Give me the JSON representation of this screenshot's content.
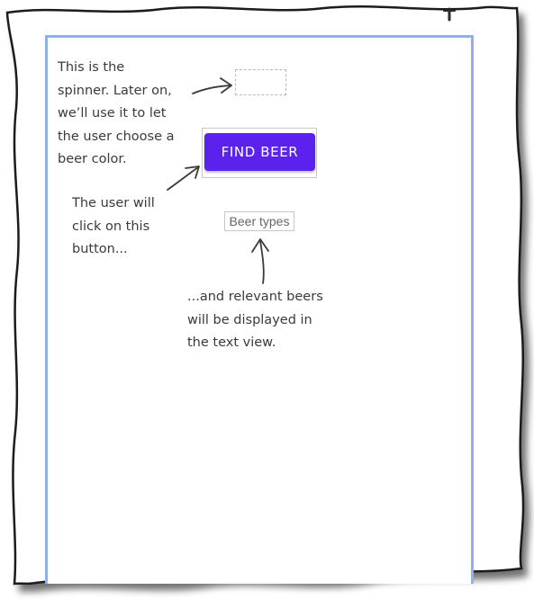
{
  "spinner": {
    "value": ""
  },
  "find_button": {
    "label": "FIND BEER"
  },
  "text_view": {
    "text": "Beer types"
  },
  "annotations": {
    "spinner_note": "This is the\nspinner. Later on,\nwe’ll use it to let\nthe user choose a\nbeer color.",
    "button_note": "The user will\nclick on this\nbutton...",
    "text_note": "...and relevant beers\nwill be displayed in\nthe text view."
  },
  "colors": {
    "button_background": "#5b22ee",
    "button_text": "#ffffff",
    "screen_border": "#8fb1e8"
  }
}
